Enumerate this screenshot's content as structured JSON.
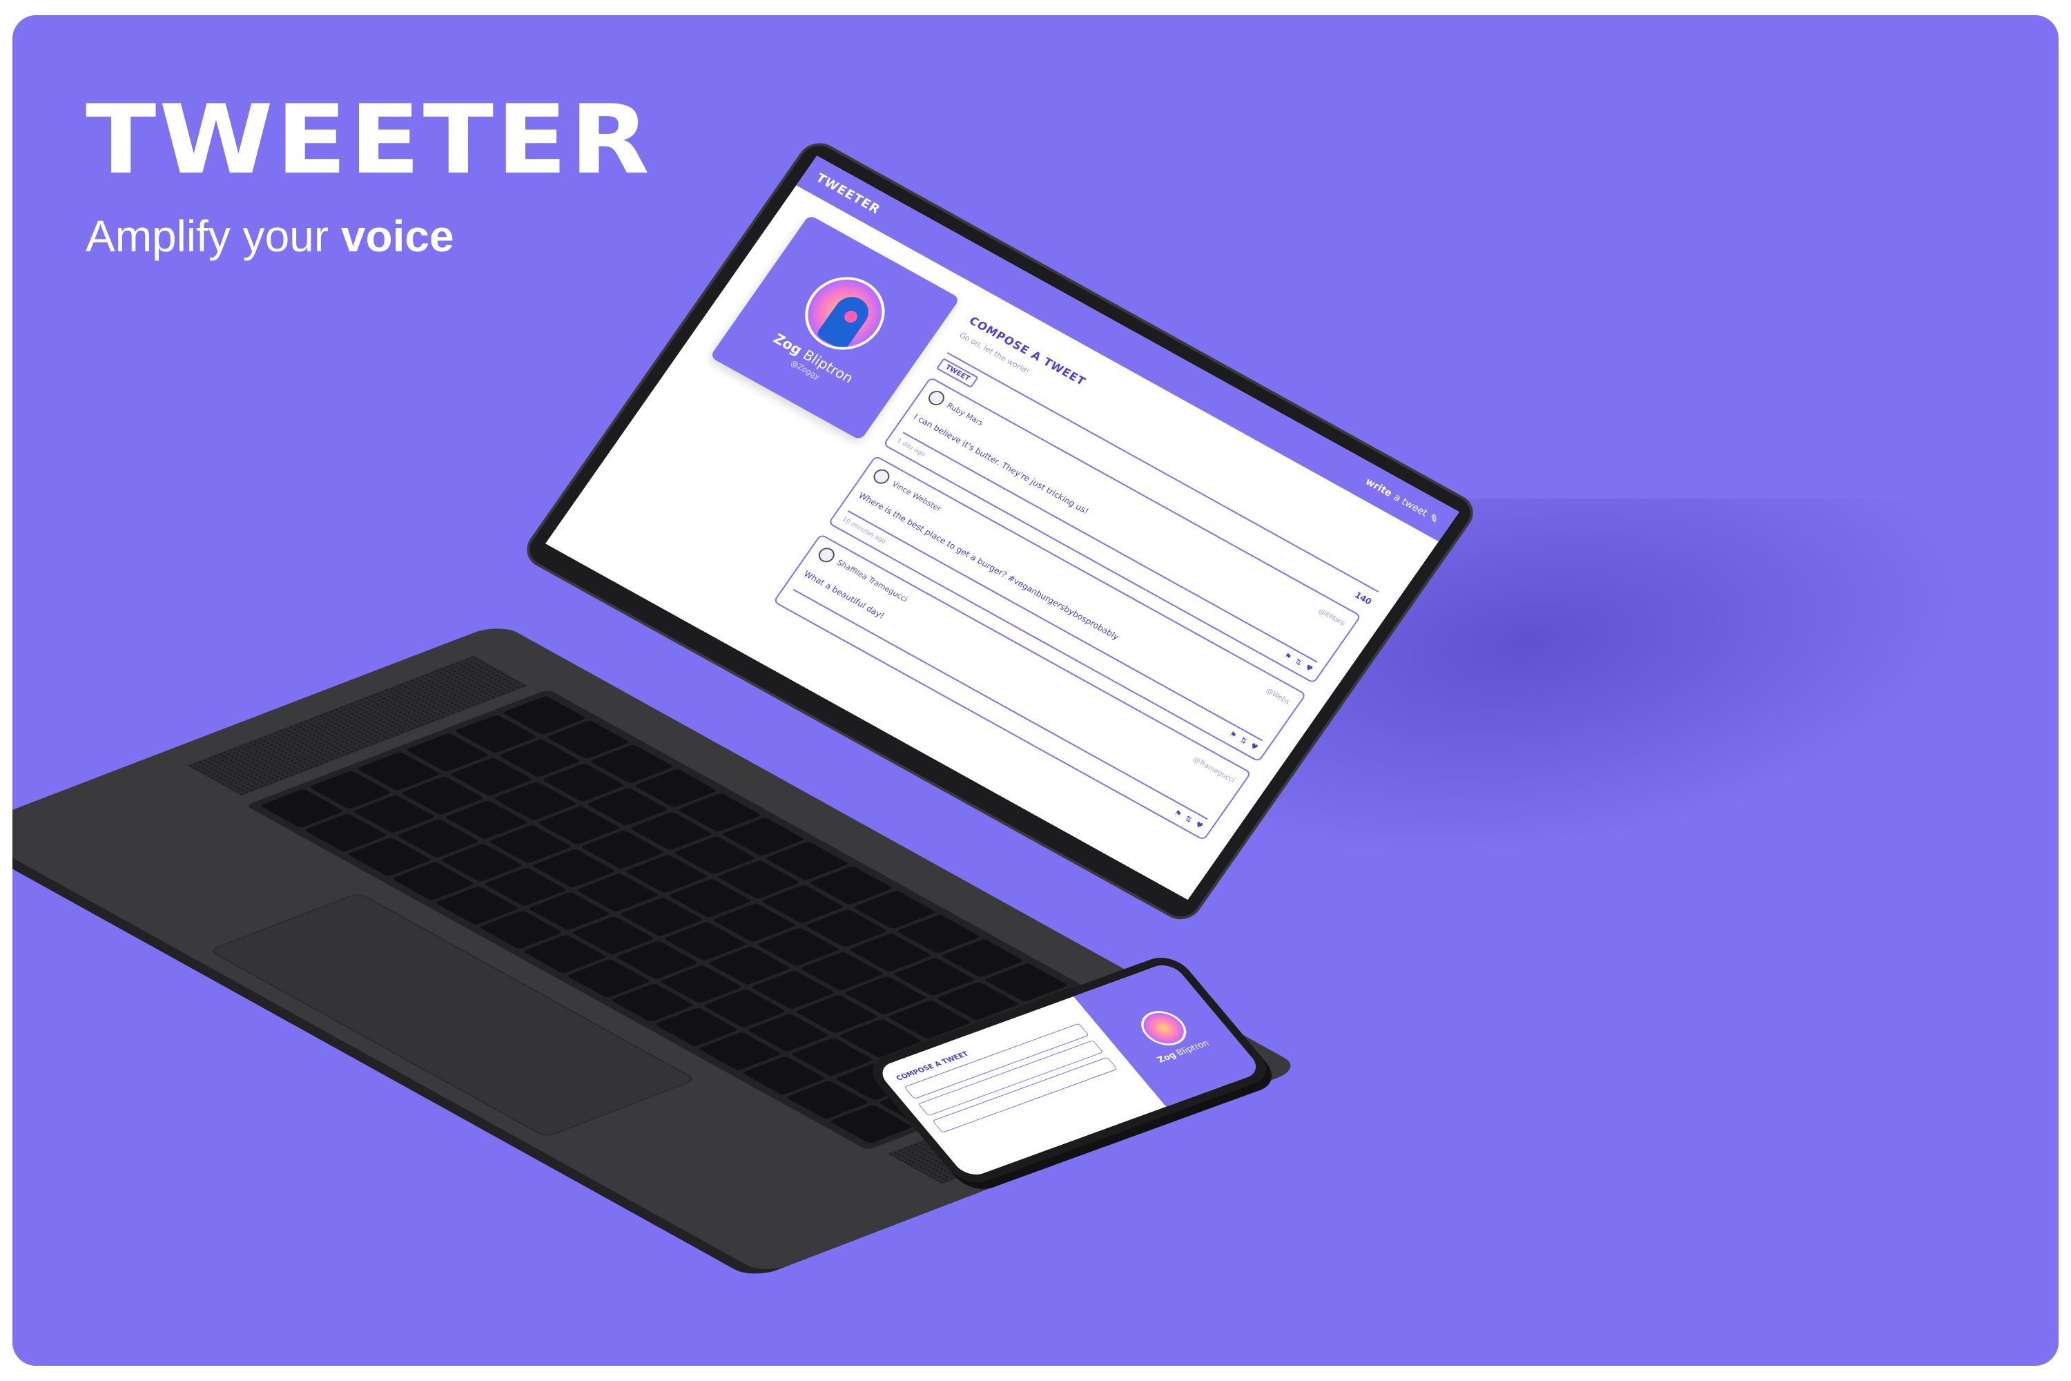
{
  "brand": {
    "title": "TWEETER",
    "tagline_prefix": "Amplify your",
    "tagline_emphasis": "voice"
  },
  "app": {
    "logo": "TWEETER",
    "nav": {
      "write_prefix": "write",
      "write_suffix": "a tweet"
    },
    "profile": {
      "first_name": "Zog",
      "last_name": "Bliptron",
      "handle": "@Zoggy"
    },
    "compose": {
      "title": "COMPOSE A TWEET",
      "placeholder": "Go on, let the world!",
      "button": "TWEET",
      "counter": "140"
    },
    "tweets": [
      {
        "name": "Ruby Mars",
        "handle": "@RMars",
        "text": "I can believe it's butter. They're just tricking us!",
        "time": "1 day ago",
        "icons": [
          "flag-icon",
          "retweet-icon",
          "heart-icon"
        ]
      },
      {
        "name": "Vince Webster",
        "handle": "@Webs",
        "text": "Where is the best place to get a burger? #veganburgersbybosprobably",
        "time": "10 minutes ago",
        "icons": [
          "flag-icon",
          "retweet-icon",
          "heart-icon"
        ]
      },
      {
        "name": "Shaffilea Tramegucci",
        "handle": "@Tramegucci",
        "text": "What a beautiful day!",
        "time": "",
        "icons": [
          "flag-icon",
          "retweet-icon",
          "heart-icon"
        ]
      }
    ]
  },
  "phone": {
    "compose_title": "COMPOSE A TWEET",
    "first_name": "Zog",
    "last_name": "Bliptron"
  },
  "colors": {
    "brand_purple": "#7e72f2",
    "accent_dark": "#4d3fd9",
    "laptop_body": "#3a3a3c"
  }
}
